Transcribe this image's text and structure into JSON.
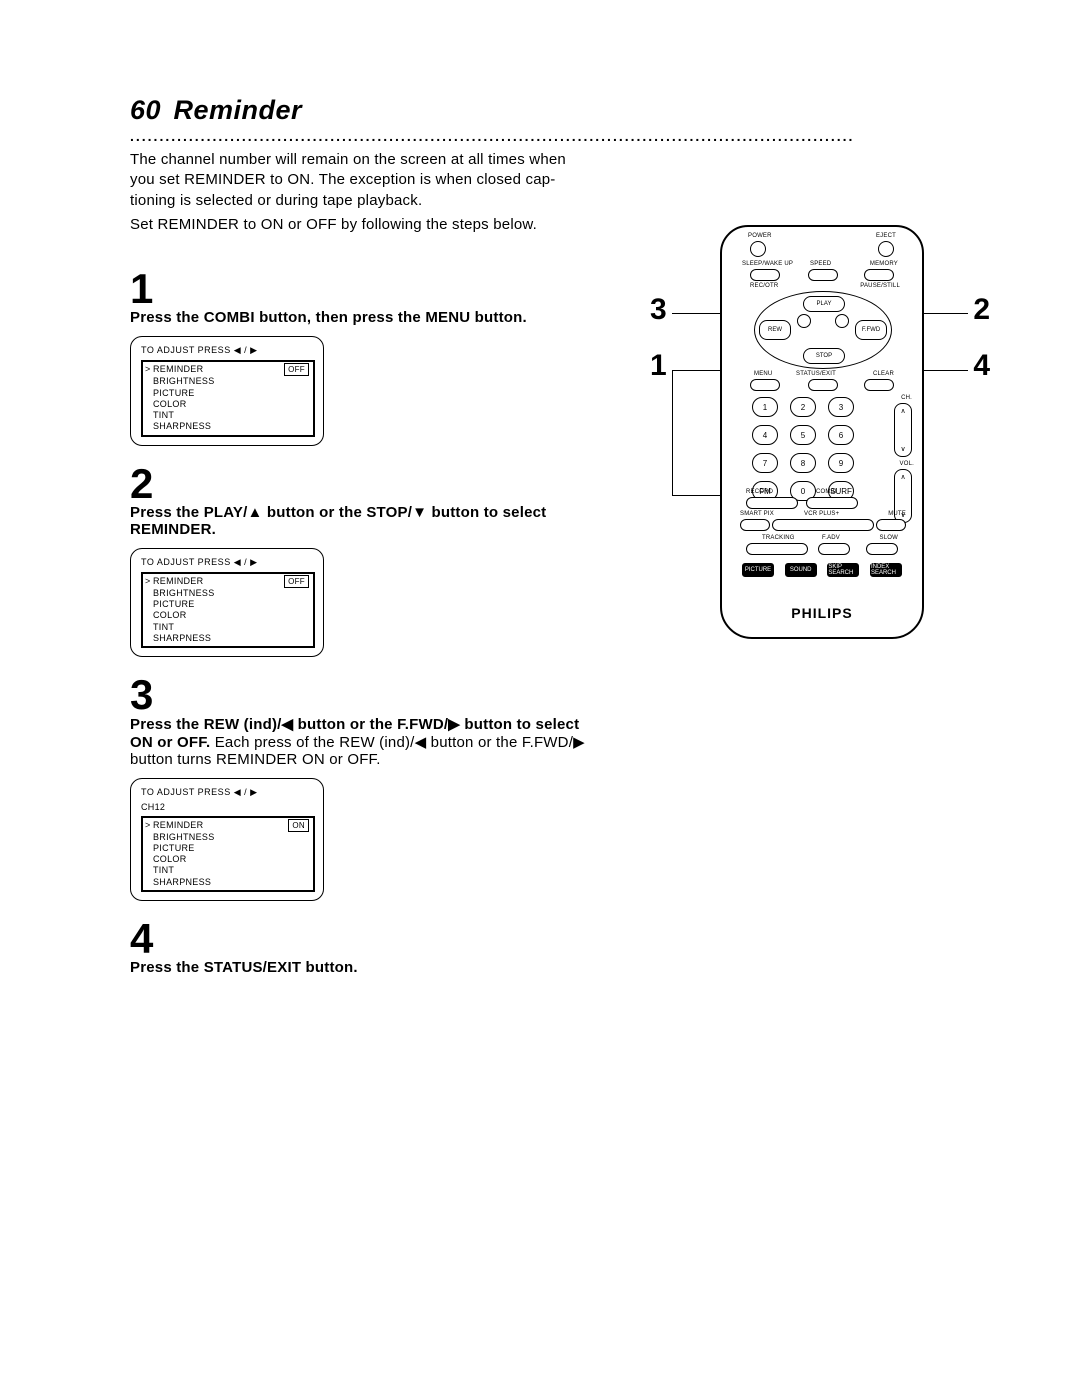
{
  "header": {
    "page_number": "60",
    "title": "Reminder"
  },
  "intro": {
    "line1": "The channel number will remain on the screen at all times when",
    "line2": "you set REMINDER to ON. The exception is when closed cap-",
    "line3": "tioning is selected or during tape playback.",
    "line4": "Set REMINDER to ON or OFF by following the steps below."
  },
  "steps": {
    "s1": {
      "num": "1",
      "text_bold": "Press the COMBI button, then press the MENU button."
    },
    "s2": {
      "num": "2",
      "text_bold_a": "Press the PLAY/",
      "text_bold_b": " button or the STOP/",
      "text_bold_c": " button to select REMINDER."
    },
    "s3": {
      "num": "3",
      "text_bold_a": "Press the REW (ind)/",
      "text_bold_b": " button or the F.FWD/",
      "text_bold_c": " button to select ON or OFF.",
      "text_reg_a": " Each press of the REW (ind)/",
      "text_reg_b": " button or the F.FWD/",
      "text_reg_c": " button turns REMINDER ON or OFF."
    },
    "s4": {
      "num": "4",
      "text_bold": "Press the STATUS/EXIT button."
    }
  },
  "osd": {
    "head": "TO ADJUST PRESS ◀ / ▶",
    "ch": "CH12",
    "items": [
      {
        "label": "REMINDER",
        "caret": ">"
      },
      {
        "label": "BRIGHTNESS",
        "caret": ""
      },
      {
        "label": "PICTURE",
        "caret": ""
      },
      {
        "label": "COLOR",
        "caret": ""
      },
      {
        "label": "TINT",
        "caret": ""
      },
      {
        "label": "SHARPNESS",
        "caret": ""
      }
    ],
    "val_off": "OFF",
    "val_on": "ON"
  },
  "remote": {
    "labels": {
      "power": "POWER",
      "eject": "EJECT",
      "sleep": "SLEEP/WAKE UP",
      "speed": "SPEED",
      "memory": "MEMORY",
      "recotr": "REC/OTR",
      "pause": "PAUSE/STILL",
      "play": "PLAY",
      "rew": "REW",
      "ffwd": "F.FWD",
      "stop": "STOP",
      "menu": "MENU",
      "status": "STATUS/EXIT",
      "clear": "CLEAR",
      "ch": "CH.",
      "vol": "VOL.",
      "fm": "FM",
      "surf": "SURF",
      "record": "RECORD",
      "combi": "COMBI",
      "vcrplus": "VCR PLUS+",
      "smartpix": "SMART PIX",
      "mute": "MUTE",
      "tracking": "TRACKING",
      "fadv": "F.ADV",
      "slow": "SLOW",
      "picture": "PICTURE",
      "sound": "SOUND",
      "skip": "SKIP SEARCH",
      "index": "INDEX SEARCH",
      "brand": "PHILIPS"
    },
    "keys": [
      "1",
      "2",
      "3",
      "4",
      "5",
      "6",
      "7",
      "8",
      "9",
      "",
      "0",
      ""
    ],
    "callouts": {
      "c1": "1",
      "c2": "2",
      "c3": "3",
      "c4": "4"
    }
  }
}
